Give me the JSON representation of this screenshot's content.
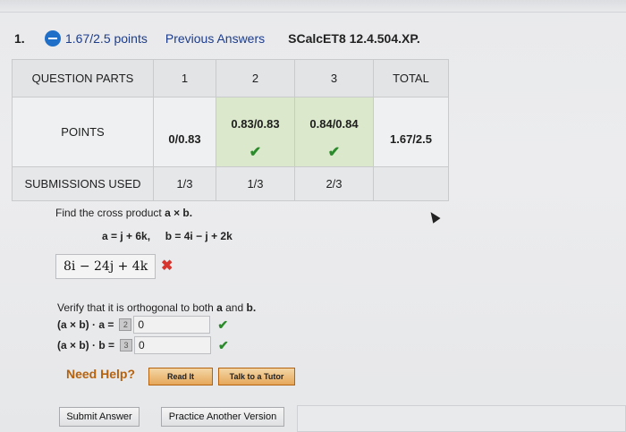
{
  "question": {
    "number": "1.",
    "points": "1.67/2.5 points",
    "previous_answers": "Previous Answers",
    "code": "SCalcET8 12.4.504.XP."
  },
  "parts_table": {
    "header": [
      "QUESTION PARTS",
      "1",
      "2",
      "3",
      "TOTAL"
    ],
    "points_label": "POINTS",
    "points": [
      "0/0.83",
      "0.83/0.83",
      "0.84/0.84",
      "1.67/2.5"
    ],
    "submissions_label": "SUBMISSIONS USED",
    "submissions": [
      "1/3",
      "1/3",
      "2/3",
      ""
    ]
  },
  "problem": {
    "prompt_text": "Find the cross product ",
    "prompt_expr": "a × b.",
    "vector_a": "a = j + 6k,",
    "vector_b": "b = 4i − j + 2k",
    "answer": "8i − 24j + 4k"
  },
  "verify": {
    "prompt_text": "Verify that it is orthogonal to both ",
    "prompt_a": "a",
    "prompt_and": " and ",
    "prompt_b": "b.",
    "row1_label": "(a × b) · a =",
    "row1_badge": "2",
    "row1_value": "0",
    "row2_label": "(a × b) · b =",
    "row2_badge": "3",
    "row2_value": "0"
  },
  "help": {
    "label": "Need Help?",
    "read_it": "Read It",
    "tutor": "Talk to a Tutor"
  },
  "buttons": {
    "submit": "Submit Answer",
    "practice": "Practice Another Version"
  },
  "colors": {
    "correct": "#2b8a2b",
    "incorrect": "#d6342c",
    "help": "#b5620f",
    "link": "#1c3c8c"
  },
  "icons": {
    "collapse": "minus-circle-icon",
    "correct": "checkmark-icon",
    "incorrect": "x-icon",
    "pointer": "mouse-cursor-icon"
  }
}
